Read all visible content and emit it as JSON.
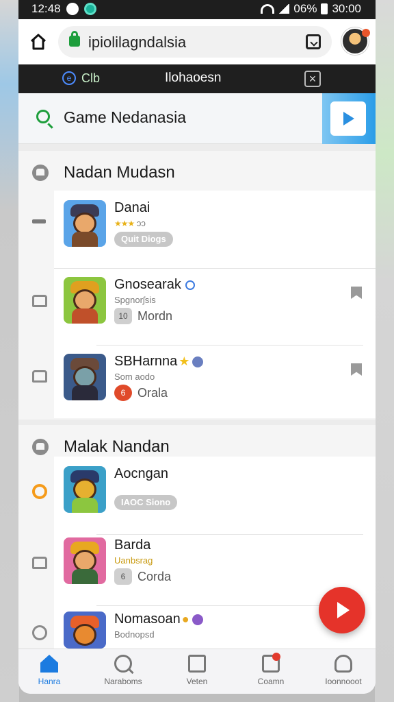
{
  "status_bar": {
    "time": "12:48",
    "battery": "06%",
    "clock": "30:00"
  },
  "browser": {
    "url": "ipiolilagndalsia"
  },
  "top_tab": {
    "left_label": "Clb",
    "title": "Ilohaoesn"
  },
  "search": {
    "query": "Game Nedanasia"
  },
  "section1": {
    "title": "Nadan Mudasn",
    "items": [
      {
        "name": "Danai",
        "sub": "ɔɔ",
        "stars": "★★★",
        "pill": "Quit Diogs",
        "thumb_bg": "#5aa4e8"
      },
      {
        "name": "Gnosearak",
        "sub": "Spgnorʃsis",
        "chip_icon": "10",
        "chip_label": "Mordn",
        "thumb_bg": "#8cc63f"
      },
      {
        "name": "SBHarnna",
        "sub": "Som aodo",
        "chip_icon": "6",
        "chip_label": "Orala",
        "thumb_bg": "#3b5a8a"
      }
    ]
  },
  "section2": {
    "title": "Malak Nandan",
    "items": [
      {
        "name": "Aocngan",
        "pill": "IAOC Siono",
        "thumb_bg": "#3ba0c8"
      },
      {
        "name": "Barda",
        "sub": "Uanbsrag",
        "chip_icon": "6",
        "chip_label": "Corda",
        "thumb_bg": "#e16aa0"
      },
      {
        "name": "Nomasoan",
        "sub": "Bodnopsd",
        "thumb_bg": "#4a6ac8"
      }
    ]
  },
  "bottom_nav": [
    {
      "label": "Hanra"
    },
    {
      "label": "Naraboms"
    },
    {
      "label": "Veten"
    },
    {
      "label": "Coamn"
    },
    {
      "label": "Ioonnooot"
    }
  ],
  "colors": {
    "accent_blue": "#1c7be0",
    "accent_green": "#1e9e3c",
    "fab_red": "#e5332a"
  }
}
